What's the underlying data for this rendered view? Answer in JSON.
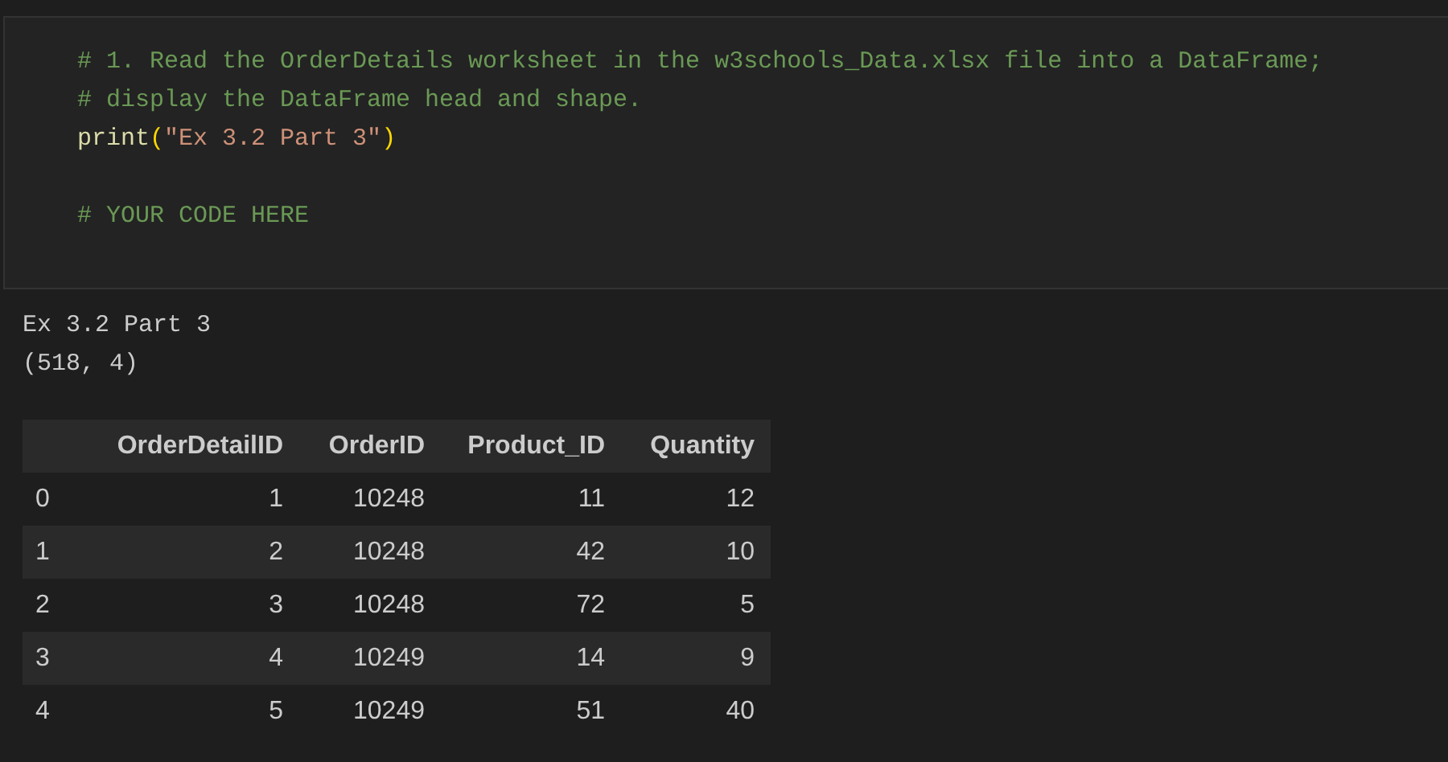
{
  "code_cell": {
    "blocks": [
      [
        {
          "tokens": [
            {
              "kind": "comment",
              "text": "# 1. Read the OrderDetails worksheet in the w3schools_Data.xlsx file into a DataFrame;"
            }
          ]
        },
        {
          "tokens": [
            {
              "kind": "comment",
              "text": "# display the DataFrame head and shape."
            }
          ]
        },
        {
          "tokens": [
            {
              "kind": "function",
              "text": "print"
            },
            {
              "kind": "paren",
              "text": "("
            },
            {
              "kind": "string",
              "text": "\"Ex 3.2 Part 3\""
            },
            {
              "kind": "paren",
              "text": ")"
            }
          ]
        }
      ],
      [
        {
          "tokens": [
            {
              "kind": "comment",
              "text": "# YOUR CODE HERE"
            }
          ]
        }
      ]
    ]
  },
  "output": {
    "lines": [
      "Ex 3.2 Part 3",
      "(518, 4)"
    ],
    "table": {
      "columns": [
        "",
        "OrderDetailID",
        "OrderID",
        "Product_ID",
        "Quantity"
      ],
      "rows": [
        [
          "0",
          "1",
          "10248",
          "11",
          "12"
        ],
        [
          "1",
          "2",
          "10248",
          "42",
          "10"
        ],
        [
          "2",
          "3",
          "10248",
          "72",
          "5"
        ],
        [
          "3",
          "4",
          "10249",
          "14",
          "9"
        ],
        [
          "4",
          "5",
          "10249",
          "51",
          "40"
        ]
      ]
    }
  }
}
